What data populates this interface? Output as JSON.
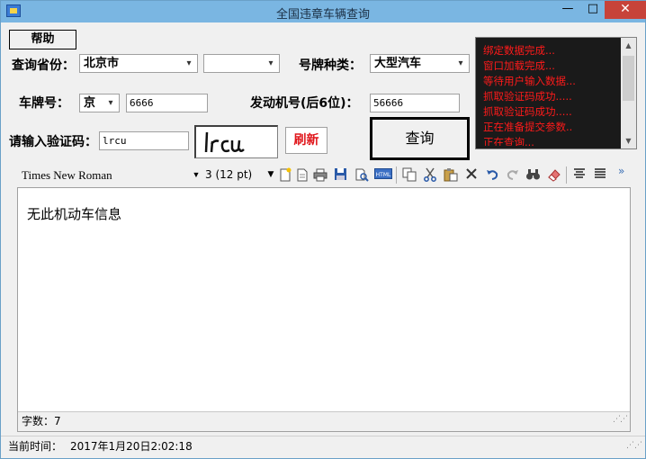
{
  "window": {
    "title": "全国违章车辆查询"
  },
  "titlebar": {
    "minimize": "—",
    "maximize": "□",
    "close": "✕"
  },
  "help_button": "帮助",
  "province": {
    "label": "查询省份：",
    "value": "北京市",
    "city_value": ""
  },
  "plate_type": {
    "label": "号牌种类：",
    "value": "大型汽车"
  },
  "plate": {
    "label": "车牌号：",
    "prefix": "京",
    "value": "6666"
  },
  "engine": {
    "label": "发动机号(后6位)：",
    "value": "56666"
  },
  "captcha": {
    "label": "请输入验证码：",
    "value": "lrcu",
    "image_text": "lrcu",
    "refresh_label": "刷新"
  },
  "query_button": "查询",
  "log": [
    "绑定数据完成...",
    "窗口加载完成...",
    "等待用户输入数据...",
    "抓取验证码成功.....",
    "抓取验证码成功.....",
    "正在准备提交参数..",
    "正在查询..."
  ],
  "editor_toolbar": {
    "font": "Times New Roman",
    "size": "3 (12 pt)",
    "more": "»"
  },
  "editor": {
    "content": "无此机动车信息",
    "word_count": "字数：7"
  },
  "statusbar": {
    "label": "当前时间：",
    "value": "2017年1月20日2:02:18"
  },
  "colors": {
    "log_bg": "#1a1a1a",
    "log_text": "#ff1a1a",
    "refresh": "#e0161b",
    "titlebar": "#7ab6e2"
  },
  "icons": [
    "new-doc-icon",
    "open-doc-icon",
    "print-icon",
    "save-icon",
    "preview-icon",
    "html-icon",
    "copy-icon",
    "cut-icon",
    "paste-icon",
    "delete-icon",
    "undo-icon",
    "redo-icon",
    "find-icon",
    "eraser-icon",
    "align-center-icon",
    "justify-icon"
  ]
}
